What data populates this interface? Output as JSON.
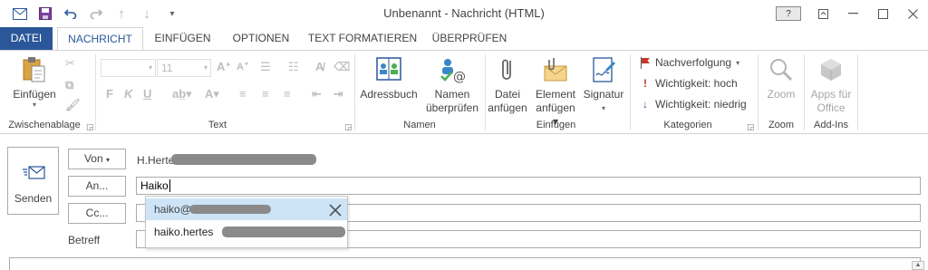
{
  "window": {
    "title": "Unbenannt - Nachricht (HTML)"
  },
  "qat": {
    "icons": [
      "envelope-icon",
      "save-icon",
      "undo-icon",
      "redo-icon",
      "up-arrow-icon",
      "down-arrow-icon",
      "customize-icon"
    ]
  },
  "tabs": [
    {
      "label": "DATEI"
    },
    {
      "label": "NACHRICHT"
    },
    {
      "label": "EINFÜGEN"
    },
    {
      "label": "OPTIONEN"
    },
    {
      "label": "TEXT FORMATIEREN"
    },
    {
      "label": "ÜBERPRÜFEN"
    }
  ],
  "ribbon": {
    "clipboard": {
      "paste": "Einfügen",
      "group": "Zwischenablage"
    },
    "text": {
      "font_size": "11",
      "group": "Text"
    },
    "names": {
      "address_book": "Adressbuch",
      "check_names_1": "Namen",
      "check_names_2": "überprüfen",
      "group": "Namen"
    },
    "include": {
      "attach_file_1": "Datei",
      "attach_file_2": "anfügen",
      "attach_item_1": "Element",
      "attach_item_2": "anfügen",
      "signature": "Signatur",
      "group": "Einfügen"
    },
    "tags": {
      "follow_up": "Nachverfolgung",
      "high_importance": "Wichtigkeit: hoch",
      "low_importance": "Wichtigkeit: niedrig",
      "group": "Kategorien"
    },
    "zoom": {
      "label": "Zoom",
      "group": "Zoom"
    },
    "addins": {
      "apps_1": "Apps für",
      "apps_2": "Office",
      "group": "Add-Ins"
    }
  },
  "message": {
    "send": "Senden",
    "from_button": "Von",
    "from_value": "H.Herte",
    "to_button": "An...",
    "to_value": "Haiko",
    "cc_button": "Cc...",
    "subject_label": "Betreff",
    "autocomplete": [
      {
        "text": "haiko@"
      },
      {
        "text": "haiko.hertes"
      }
    ]
  },
  "colors": {
    "accent": "#2b579a",
    "selection": "#cde4f7",
    "flag": "#c0392b"
  }
}
